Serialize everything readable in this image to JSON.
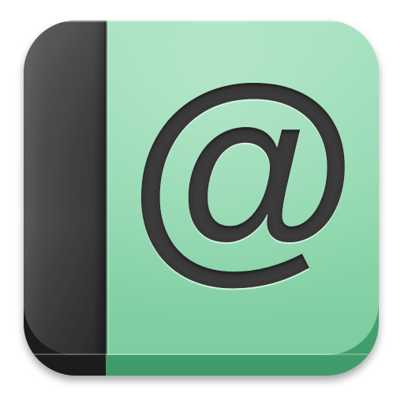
{
  "app_icon": {
    "symbol": "@",
    "icon_name": "address-book-at-icon",
    "colors": {
      "cover": "#8fd8ad",
      "cover_edge": "#5fb385",
      "spine": "#3a3a3a",
      "symbol": "#3b3b3b"
    }
  }
}
